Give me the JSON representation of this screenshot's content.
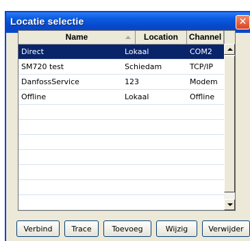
{
  "window": {
    "title": "Locatie selectie",
    "close_glyph": "✕"
  },
  "grid": {
    "columns": [
      "Name",
      "Location",
      "Channel"
    ],
    "rows": [
      {
        "name": "Direct",
        "location": "Lokaal",
        "channel": "COM2",
        "selected": true
      },
      {
        "name": "SM720 test",
        "location": "Schiedam",
        "channel": "TCP/IP",
        "selected": false
      },
      {
        "name": "DanfossService",
        "location": "123",
        "channel": "Modem",
        "selected": false
      },
      {
        "name": "Offline",
        "location": "Lokaal",
        "channel": "Offline",
        "selected": false
      }
    ]
  },
  "buttons": {
    "connect": "Verbind",
    "trace": "Trace",
    "add": "Toevoeg",
    "edit": "Wijzig",
    "delete": "Verwijder"
  },
  "colors": {
    "titlebar": "#0a5ce0",
    "selection": "#0a246a",
    "close": "#d84523"
  },
  "icons": {
    "sort": "sort-ascending-icon",
    "scroll_up": "arrow-up-icon",
    "scroll_down": "arrow-down-icon",
    "close": "close-icon"
  }
}
